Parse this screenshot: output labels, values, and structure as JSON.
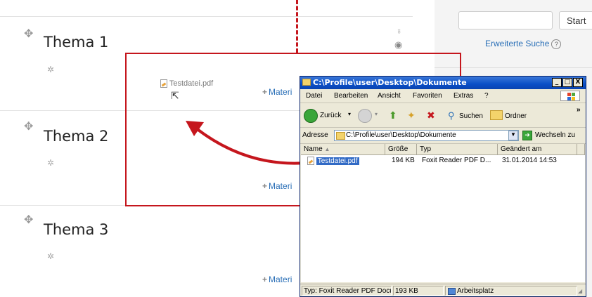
{
  "course": {
    "topics": [
      {
        "title": "Thema 1"
      },
      {
        "title": "Thema 2"
      },
      {
        "title": "Thema 3"
      }
    ],
    "add_material_label": "Materi",
    "dragged_file": "Testdatei.pdf"
  },
  "search": {
    "button_label": "Start",
    "advanced_link": "Erweiterte Suche",
    "input_value": ""
  },
  "explorer": {
    "title": "C:\\Profile\\user\\Desktop\\Dokumente",
    "window_buttons": [
      "_",
      "□",
      "X"
    ],
    "menu": [
      "Datei",
      "Bearbeiten",
      "Ansicht",
      "Favoriten",
      "Extras",
      "?"
    ],
    "toolbar": {
      "back_label": "Zurück",
      "search_label": "Suchen",
      "folders_label": "Ordner",
      "more": "»"
    },
    "address": {
      "label": "Adresse",
      "path": "C:\\Profile\\user\\Desktop\\Dokumente",
      "go_label": "Wechseln zu"
    },
    "columns": [
      "Name",
      "Größe",
      "Typ",
      "Geändert am"
    ],
    "files": [
      {
        "name": "Testdatei.pdf",
        "size": "194 KB",
        "type": "Foxit Reader PDF D...",
        "modified": "31.01.2014 14:53"
      }
    ],
    "status": {
      "type": "Typ: Foxit Reader PDF Docu",
      "size": "193 KB",
      "location": "Arbeitsplatz"
    }
  },
  "colors": {
    "highlight": "#c5161d",
    "link": "#2a6fb7",
    "xp_title": "#0a4fc7"
  }
}
